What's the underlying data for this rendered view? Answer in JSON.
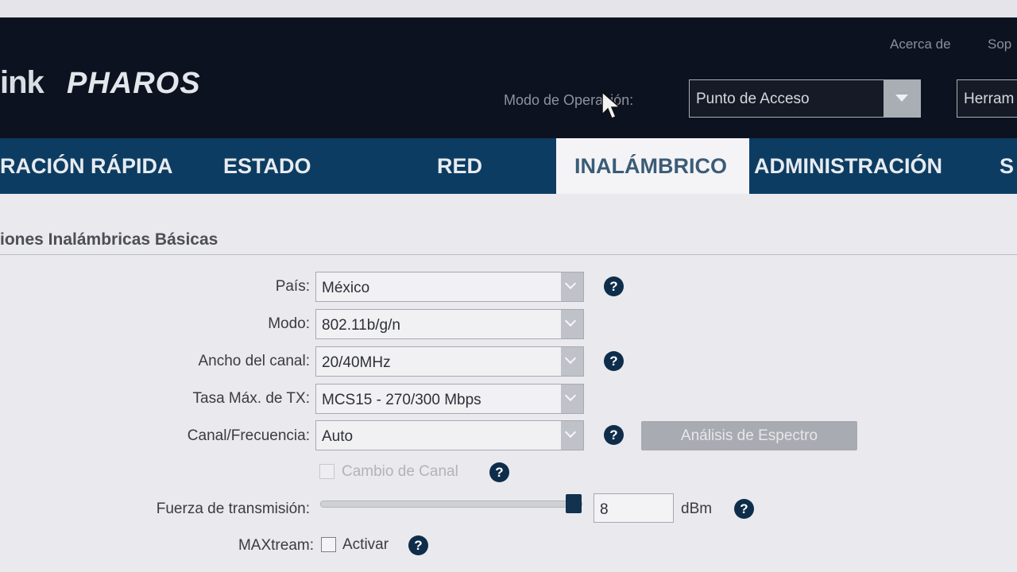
{
  "header": {
    "brand_partial": "ink",
    "brand_product": "PHAROS",
    "links": [
      "Acerca de",
      "Sop"
    ],
    "opmode_label": "Modo de Operación:",
    "opmode_value": "Punto de Acceso",
    "tools_partial": "Herram"
  },
  "nav": {
    "tabs": [
      "RACIÓN RÁPIDA",
      "ESTADO",
      "RED",
      "INALÁMBRICO",
      "ADMINISTRACIÓN",
      "S"
    ],
    "active_index": 3
  },
  "section": {
    "title": "iones Inalámbricas Básicas"
  },
  "form": {
    "country": {
      "label": "País:",
      "value": "México"
    },
    "mode": {
      "label": "Modo:",
      "value": "802.11b/g/n"
    },
    "channel_width": {
      "label": "Ancho del canal:",
      "value": "20/40MHz"
    },
    "max_tx_rate": {
      "label": "Tasa Máx. de TX:",
      "value": "MCS15 - 270/300 Mbps"
    },
    "channel_freq": {
      "label": "Canal/Frecuencia:",
      "value": "Auto"
    },
    "spectrum_button": "Análisis de Espectro",
    "channel_change": {
      "label": "Cambio de Canal",
      "checked": false,
      "disabled": true
    },
    "tx_power": {
      "label": "Fuerza de transmisión:",
      "value": "8",
      "unit": "dBm",
      "slider_fraction": 1.0
    },
    "maxtream": {
      "label": "MAXtream:",
      "option": "Activar",
      "checked": false
    }
  },
  "help_glyph": "?",
  "colors": {
    "header_bg": "#0d1220",
    "nav_bg": "#0d3c62",
    "nav_active_bg": "#f4f4f7",
    "help_icon": "#0e2d4a",
    "page_bg": "#e9e9ee"
  }
}
